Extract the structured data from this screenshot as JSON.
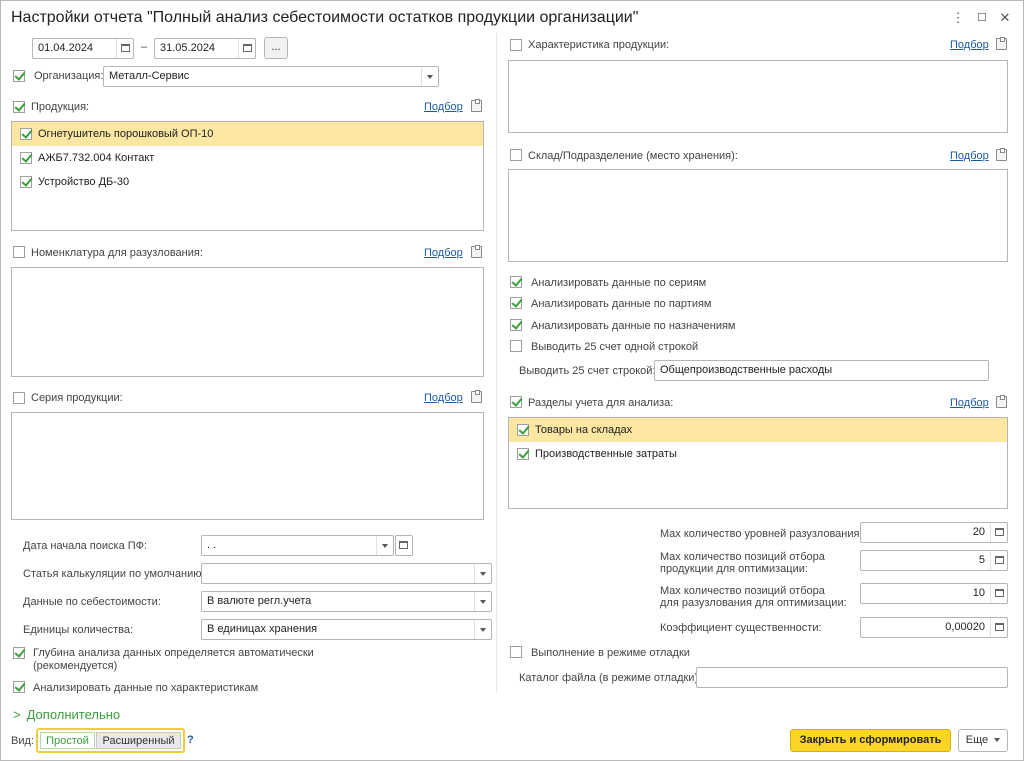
{
  "window": {
    "title": "Настройки отчета \"Полный анализ себестоимости остатков продукции организации\"",
    "menu_glyph": "⋮",
    "maximize_glyph": "☐",
    "close_glyph": "✕"
  },
  "period": {
    "from": "01.04.2024",
    "dash": "–",
    "to": "31.05.2024",
    "more_label": "..."
  },
  "organization": {
    "label": "Организация:",
    "value": "Металл-Сервис",
    "checked": true
  },
  "products": {
    "label": "Продукция:",
    "pick_label": "Подбор",
    "checked": true,
    "items": [
      {
        "label": "Огнетушитель порошковый ОП-10",
        "checked": true,
        "selected": true
      },
      {
        "label": "АЖБ7.732.004 Контакт",
        "checked": true,
        "selected": false
      },
      {
        "label": "Устройство ДБ-30",
        "checked": true,
        "selected": false
      }
    ]
  },
  "nomenclature": {
    "label": "Номенклатура для разузлования:",
    "pick_label": "Подбор",
    "checked": false
  },
  "series": {
    "label": "Серия продукции:",
    "pick_label": "Подбор",
    "checked": false
  },
  "params": {
    "start_date_label": "Дата начала поиска ПФ:",
    "start_date_value": " .  .",
    "calc_item_label": "Статья калькуляции по умолчанию:",
    "calc_item_value": "",
    "cost_data_label": "Данные по себестоимости:",
    "cost_data_value": "В валюте регл.учета",
    "units_label": "Единицы количества:",
    "units_value": "В единицах хранения"
  },
  "depth_auto": {
    "label_line1": "Глубина анализа данных определяется автоматически",
    "label_line2": "(рекомендуется)",
    "checked": true
  },
  "analyze_characteristics": {
    "label": "Анализировать данные по характеристикам",
    "checked": true
  },
  "characteristic": {
    "label": "Характеристика продукции:",
    "pick_label": "Подбор",
    "checked": false
  },
  "warehouse": {
    "label": "Склад/Подразделение (место хранения):",
    "pick_label": "Подбор",
    "checked": false
  },
  "options": [
    {
      "label": "Анализировать данные по сериям",
      "checked": true
    },
    {
      "label": "Анализировать данные по партиям",
      "checked": true
    },
    {
      "label": "Анализировать данные по назначениям",
      "checked": true
    },
    {
      "label": "Выводить 25 счет одной строкой",
      "checked": false
    }
  ],
  "account25": {
    "label": "Выводить 25 счет строкой:",
    "value": "Общепроизводственные расходы"
  },
  "sections": {
    "label": "Разделы учета для анализа:",
    "pick_label": "Подбор",
    "checked": true,
    "items": [
      {
        "label": "Товары на складах",
        "checked": true,
        "selected": true
      },
      {
        "label": "Производственные затраты",
        "checked": true,
        "selected": false
      }
    ]
  },
  "numeric": {
    "max_levels_label": "Max количество уровней разузлования:",
    "max_levels_value": "20",
    "max_products_label_1": "Max количество позиций отбора",
    "max_products_label_2": "продукции для оптимизации:",
    "max_products_value": "5",
    "max_disassembly_label_1": "Max количество позиций отбора",
    "max_disassembly_label_2": "для разузлования для оптимизации:",
    "max_disassembly_value": "10",
    "coef_label": "Коэффициент существенности:",
    "coef_value": "0,00020"
  },
  "debug": {
    "label": "Выполнение в режиме отладки",
    "checked": false,
    "catalog_label": "Каталог файла (в режиме отладки):",
    "catalog_value": ""
  },
  "additional": {
    "label": "Дополнительно",
    "chevron": ">"
  },
  "view": {
    "label": "Вид:",
    "simple": "Простой",
    "extended": "Расширенный",
    "help": "?"
  },
  "footer": {
    "submit": "Закрыть и сформировать",
    "more": "Еще"
  },
  "colors": {
    "accent_green": "#3a9e3a",
    "selected_row": "#fbe6a2",
    "primary_button": "#fbd627",
    "link": "#1c5aa8"
  }
}
